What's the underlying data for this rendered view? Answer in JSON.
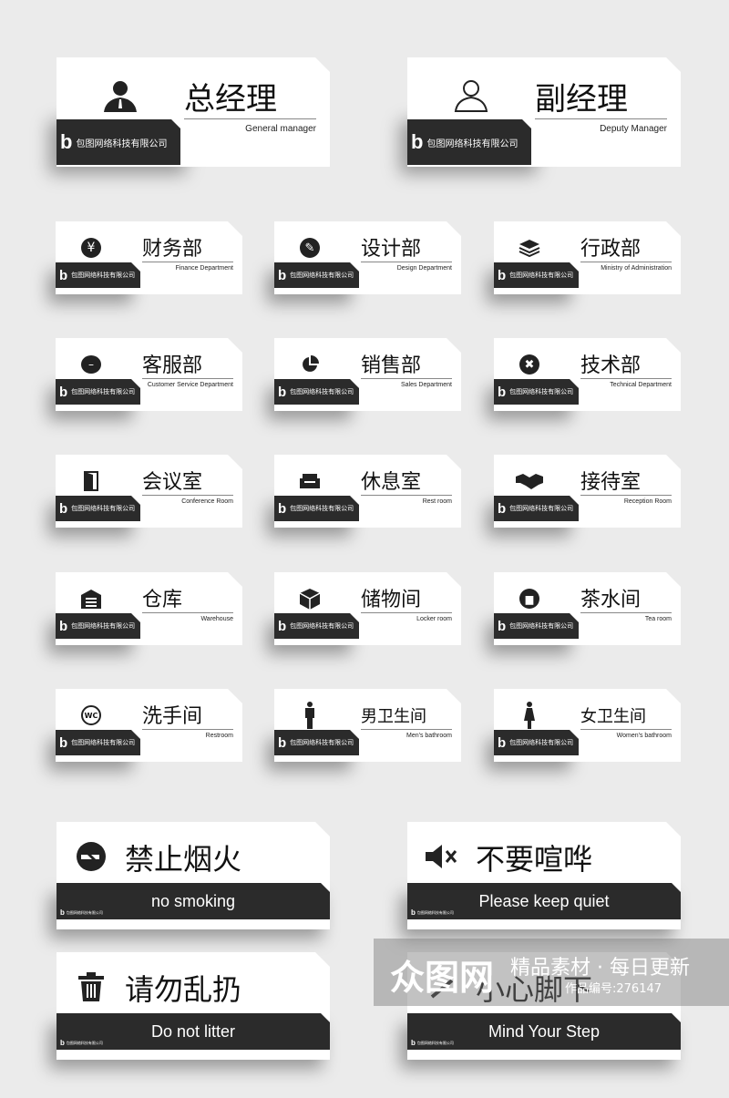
{
  "company": "包图网络科技有限公司",
  "logo_letter": "b",
  "large_signs": [
    {
      "title": "总经理",
      "subtitle": "General manager",
      "icon": "manager-filled-icon"
    },
    {
      "title": "副经理",
      "subtitle": "Deputy Manager",
      "icon": "manager-outline-icon"
    }
  ],
  "small_signs": [
    {
      "title": "财务部",
      "subtitle": "Finance Department",
      "icon": "yen-icon"
    },
    {
      "title": "设计部",
      "subtitle": "Design Department",
      "icon": "pencil-icon"
    },
    {
      "title": "行政部",
      "subtitle": "Ministry of Administration",
      "icon": "layers-icon"
    },
    {
      "title": "客服部",
      "subtitle": "Customer Service Department",
      "icon": "chat-icon"
    },
    {
      "title": "销售部",
      "subtitle": "Sales Department",
      "icon": "pie-chart-icon"
    },
    {
      "title": "技术部",
      "subtitle": "Technical Department",
      "icon": "tools-icon"
    },
    {
      "title": "会议室",
      "subtitle": "Conference Room",
      "icon": "door-icon"
    },
    {
      "title": "休息室",
      "subtitle": "Rest room",
      "icon": "sofa-icon"
    },
    {
      "title": "接待室",
      "subtitle": "Reception Room",
      "icon": "handshake-icon"
    },
    {
      "title": "仓库",
      "subtitle": "Warehouse",
      "icon": "warehouse-icon"
    },
    {
      "title": "储物间",
      "subtitle": "Locker room",
      "icon": "box-icon"
    },
    {
      "title": "茶水间",
      "subtitle": "Tea room",
      "icon": "cup-icon"
    },
    {
      "title": "洗手间",
      "subtitle": "Restroom",
      "icon": "wc-icon"
    },
    {
      "title": "男卫生间",
      "subtitle": "Men's bathroom",
      "icon": "man-icon"
    },
    {
      "title": "女卫生间",
      "subtitle": "Women's bathroom",
      "icon": "woman-icon"
    }
  ],
  "notice_signs": [
    {
      "title": "禁止烟火",
      "subtitle": "no smoking",
      "icon": "no-smoking-icon"
    },
    {
      "title": "不要喧哗",
      "subtitle": "Please keep quiet",
      "icon": "speaker-mute-icon"
    },
    {
      "title": "请勿乱扔",
      "subtitle": "Do not litter",
      "icon": "trash-icon"
    },
    {
      "title": "小心脚下",
      "subtitle": "Mind Your Step",
      "icon": "step-icon"
    }
  ],
  "watermark": {
    "brand": "众图网",
    "slogan": "精品素材 · 每日更新",
    "id_text": "作品编号:276147"
  }
}
